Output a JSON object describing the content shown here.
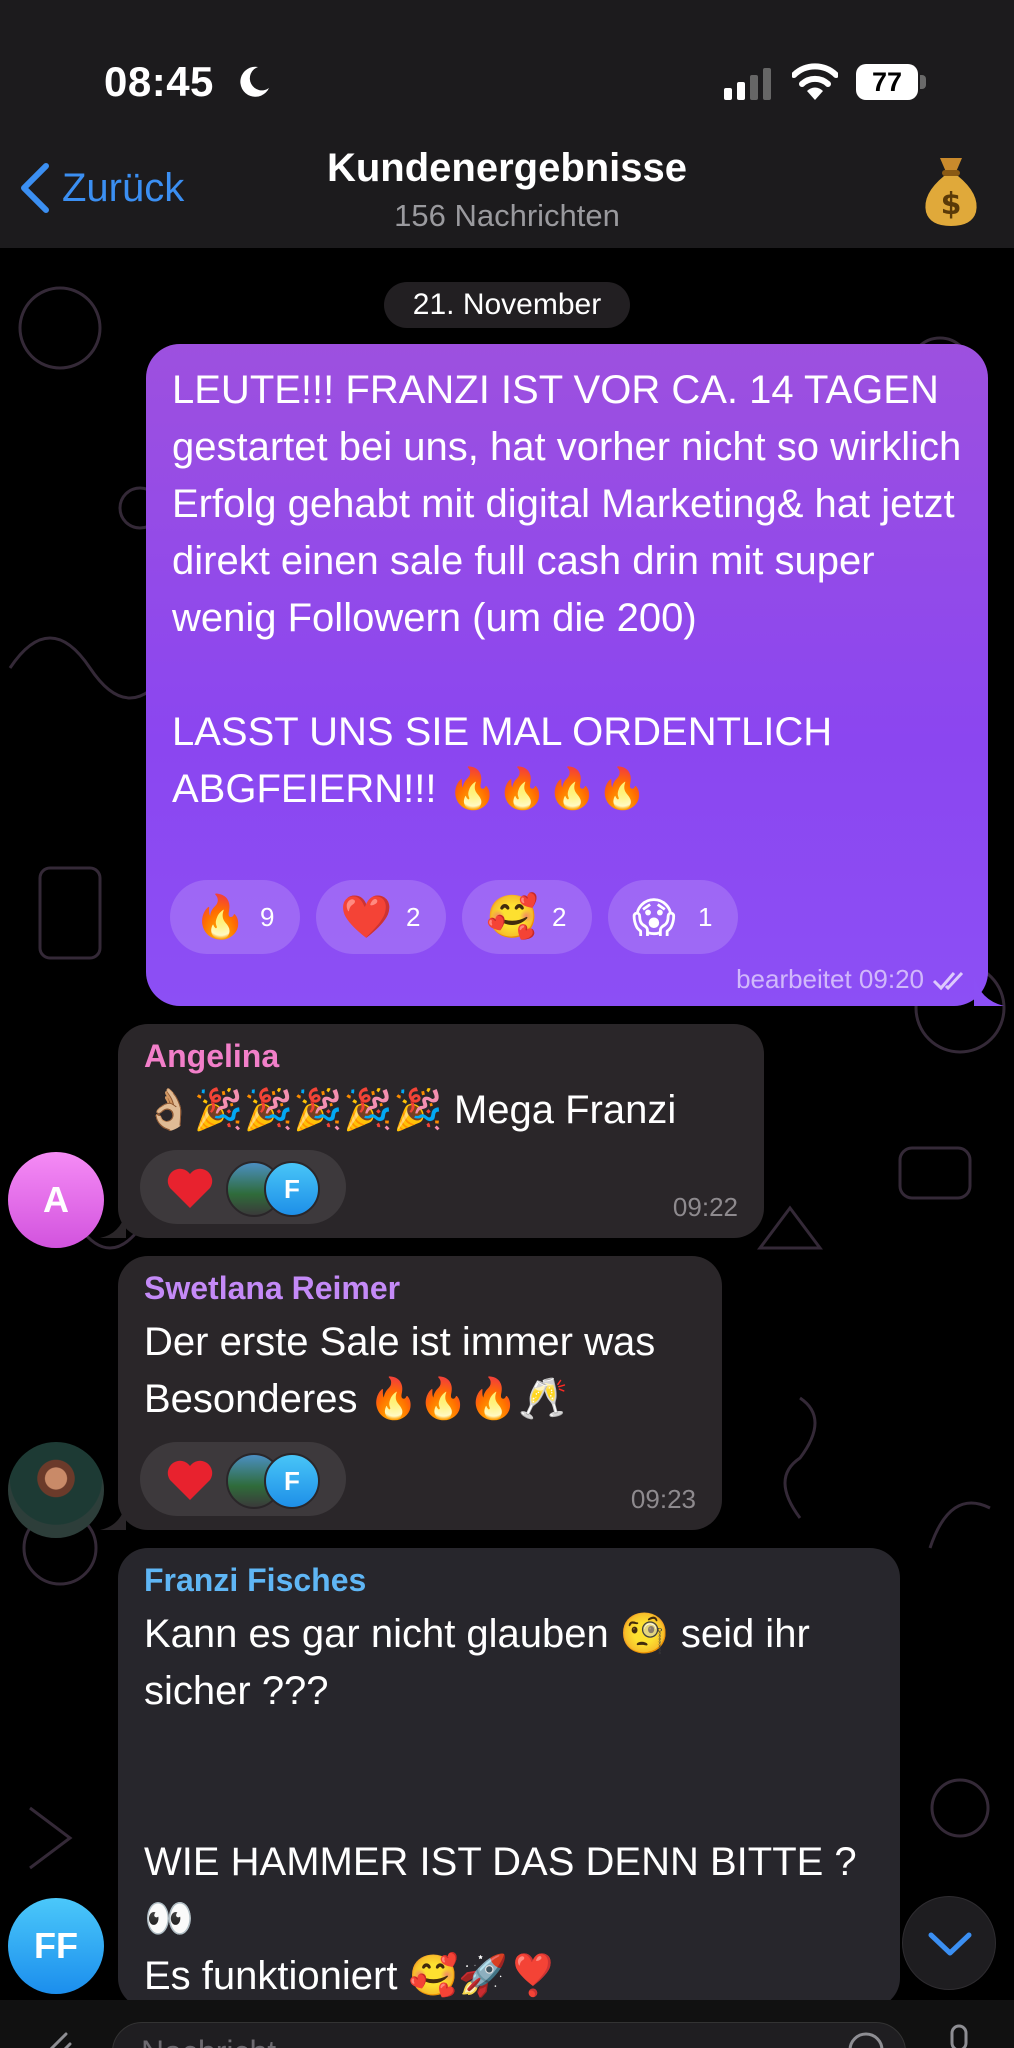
{
  "status_bar": {
    "time": "08:45",
    "battery": "77"
  },
  "header": {
    "back_label": "Zurück",
    "title": "Kundenergebnisse",
    "subtitle": "156 Nachrichten",
    "group_avatar_icon": "money-bag-icon"
  },
  "date_separator": "21. November",
  "outgoing_message": {
    "text": "LEUTE!!! FRANZI IST VOR CA. 14 TAGEN gestartet bei uns, hat vorher nicht so wirklich Erfolg gehabt mit digital Marketing& hat jetzt direkt einen sale full cash drin mit super wenig Followern (um die 200)\n\nLASST UNS SIE MAL ORDENTLICH ABGFEIERN!!! 🔥🔥🔥🔥",
    "reactions": [
      {
        "emoji": "🔥",
        "count": "9"
      },
      {
        "emoji": "❤️",
        "count": "2"
      },
      {
        "emoji": "🥰",
        "count": "2"
      },
      {
        "emoji": "😱",
        "count": "1"
      }
    ],
    "meta": "bearbeitet 09:20",
    "bubble_color": "#8c4ff5"
  },
  "messages": [
    {
      "sender": "Angelina",
      "sender_color": "#f27fc9",
      "text": "👌🏼🎉🎉🎉🎉🎉 Mega Franzi",
      "time": "09:22",
      "avatar_initial": "A",
      "reaction_avatar_initial": "F"
    },
    {
      "sender": "Swetlana Reimer",
      "sender_color": "#c48af7",
      "text": "Der erste Sale ist immer was Besonderes 🔥🔥🔥🥂",
      "time": "09:23",
      "reaction_avatar_initial": "F"
    },
    {
      "sender": "Franzi Fisches",
      "sender_color": "#5fb6f5",
      "text": "Kann es gar nicht glauben 🧐 seid ihr sicher ???\n\n\nWIE HAMMER IST DAS DENN BITTE ? 👀\nEs funktioniert 🥰🚀❣️",
      "avatar_initial": "FF"
    }
  ],
  "input": {
    "placeholder": "Nachricht"
  }
}
